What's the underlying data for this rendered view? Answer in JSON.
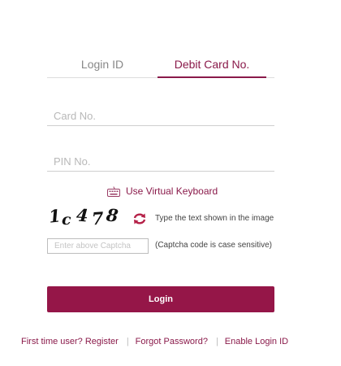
{
  "tabs": {
    "login_id": "Login ID",
    "debit_card": "Debit Card No."
  },
  "form": {
    "card_placeholder": "Card No.",
    "pin_placeholder": "PIN No.",
    "virtual_keyboard_label": "Use Virtual Keyboard",
    "virtual_keyboard_icon": "keyboard-icon",
    "captcha_characters": [
      "1",
      "c",
      "4",
      "7",
      "8"
    ],
    "refresh_icon": "refresh-icon",
    "captcha_hint": "Type the text shown in the image",
    "captcha_placeholder": "Enter above Captcha",
    "case_note": "(Captcha code is case sensitive)",
    "login_button": "Login"
  },
  "footer": {
    "register": "First time user? Register",
    "forgot_password": "Forgot Password?",
    "enable_login_id": "Enable Login ID",
    "separator": "|"
  },
  "colors": {
    "brand": "#951648",
    "link": "#8a1a4a",
    "muted_text": "#888888",
    "border": "#cfcfcf"
  }
}
